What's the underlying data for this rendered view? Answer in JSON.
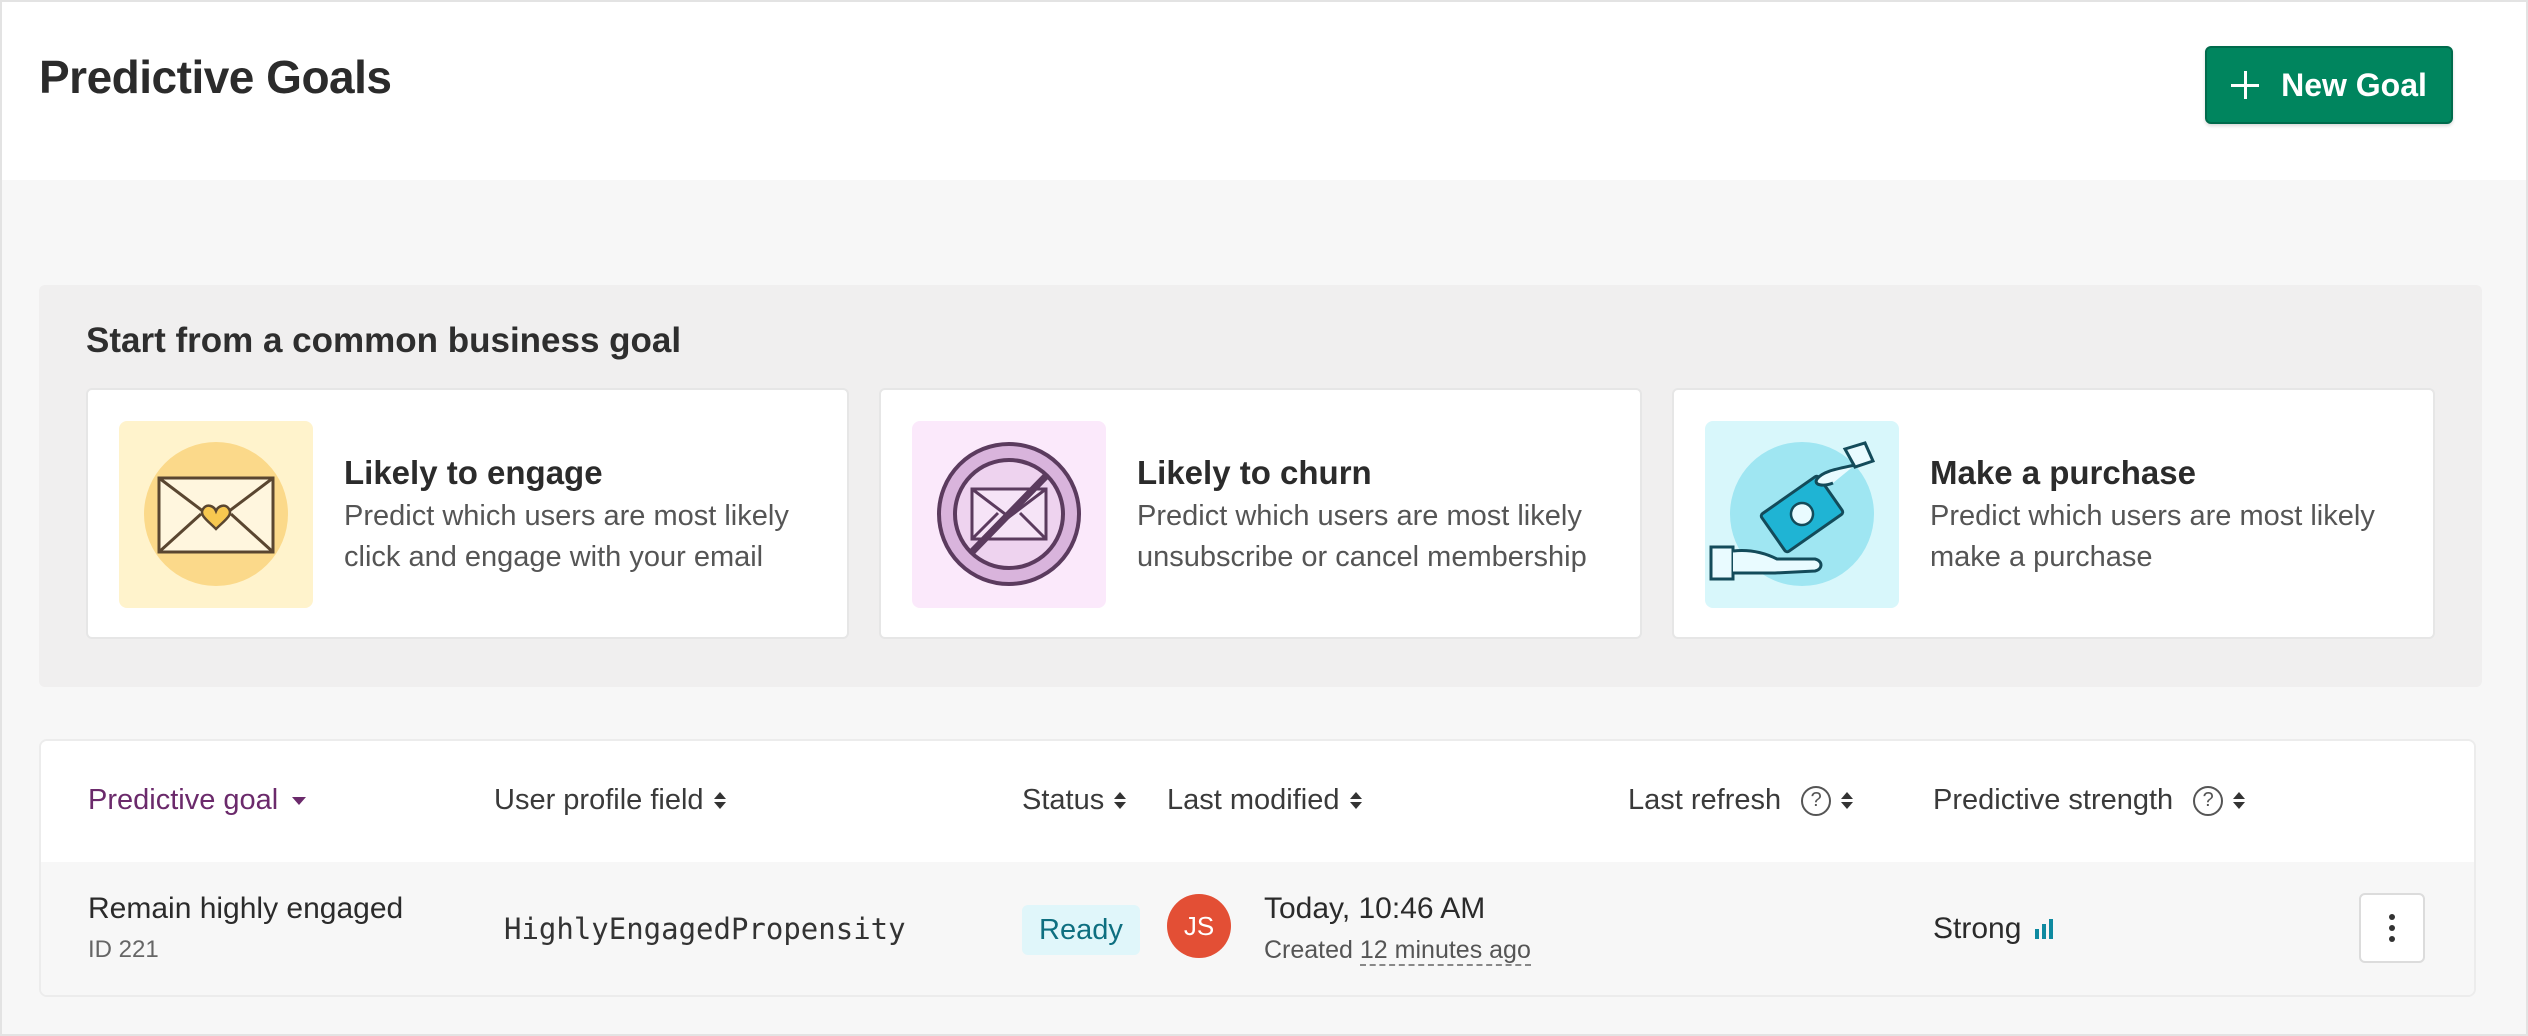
{
  "header": {
    "title": "Predictive Goals",
    "new_goal_label": "New Goal"
  },
  "suggestions": {
    "heading": "Start from a common business goal",
    "cards": [
      {
        "title": "Likely to engage",
        "description": "Predict which users are most likely click and engage with your email",
        "icon": "envelope-heart-icon"
      },
      {
        "title": "Likely to churn",
        "description": "Predict which users are most likely unsubscribe or cancel membership",
        "icon": "no-envelope-icon"
      },
      {
        "title": "Make a purchase",
        "description": "Predict which users are most likely make a purchase",
        "icon": "money-handoff-icon"
      }
    ]
  },
  "table": {
    "columns": {
      "goal": "Predictive goal",
      "profile_field": "User profile field",
      "status": "Status",
      "last_modified": "Last modified",
      "last_refresh": "Last refresh",
      "strength": "Predictive strength"
    },
    "rows": [
      {
        "name": "Remain highly engaged",
        "id": "ID 221",
        "profile_field": "HighlyEngagedPropensity",
        "status": "Ready",
        "avatar_initials": "JS",
        "modified": "Today, 10:46 AM",
        "created_prefix": "Created",
        "created_ago": "12 minutes ago",
        "last_refresh": "",
        "strength": "Strong"
      }
    ]
  },
  "colors": {
    "primary_button": "#00855e",
    "active_sort": "#6b2a6b",
    "status_ready_bg": "#e0f6fa",
    "status_ready_text": "#0e6f80",
    "avatar": "#e34f35",
    "strength_bars": "#0e8aa0"
  }
}
